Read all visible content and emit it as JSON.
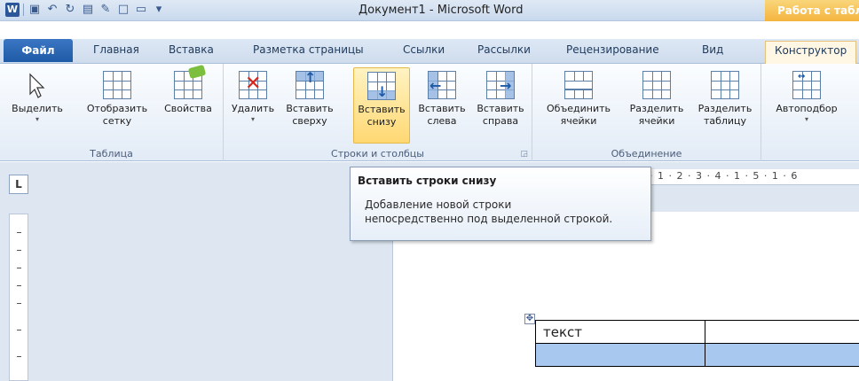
{
  "titlebar": {
    "title": "Документ1 - Microsoft Word",
    "contextual_group": "Работа с табл"
  },
  "tabs": [
    {
      "label": "Файл"
    },
    {
      "label": "Главная"
    },
    {
      "label": "Вставка"
    },
    {
      "label": "Разметка страницы"
    },
    {
      "label": "Ссылки"
    },
    {
      "label": "Рассылки"
    },
    {
      "label": "Рецензирование"
    },
    {
      "label": "Вид"
    },
    {
      "label": "Конструктор"
    }
  ],
  "ribbon": {
    "groups": [
      {
        "label": "Таблица",
        "buttons": [
          {
            "line1": "Выделить",
            "line2": "▾"
          },
          {
            "line1": "Отобразить",
            "line2": "сетку"
          },
          {
            "line1": "Свойства",
            "line2": ""
          }
        ]
      },
      {
        "label": "Строки и столбцы",
        "buttons": [
          {
            "line1": "Удалить",
            "line2": "▾"
          },
          {
            "line1": "Вставить",
            "line2": "сверху"
          },
          {
            "line1": "Вставить",
            "line2": "снизу"
          },
          {
            "line1": "Вставить",
            "line2": "слева"
          },
          {
            "line1": "Вставить",
            "line2": "справа"
          }
        ]
      },
      {
        "label": "Объединение",
        "buttons": [
          {
            "line1": "Объединить",
            "line2": "ячейки"
          },
          {
            "line1": "Разделить",
            "line2": "ячейки"
          },
          {
            "line1": "Разделить",
            "line2": "таблицу"
          }
        ]
      },
      {
        "label": "",
        "buttons": [
          {
            "line1": "Автоподбор",
            "line2": "▾"
          }
        ]
      }
    ]
  },
  "ruler": {
    "corner_mark": "L",
    "horizontal_text": "· 1 · 2 · 3 · 4 · 1 · 5 · 1 · 6"
  },
  "tooltip": {
    "title": "Вставить строки снизу",
    "body_line1": "Добавление новой строки",
    "body_line2": "непосредственно под выделенной строкой."
  },
  "document": {
    "table_handle": "✥",
    "rows": [
      [
        "текст",
        ""
      ],
      [
        "",
        ""
      ]
    ]
  },
  "colors": {
    "file_tab": "#1f5aa6",
    "contextual_group": "#f4b43f",
    "selected_row": "#a9c8ef",
    "highlight_button": "#ffd873"
  },
  "icons": {
    "word_logo": "W",
    "save": "save-icon",
    "undo": "undo-icon",
    "redo": "redo-icon"
  }
}
